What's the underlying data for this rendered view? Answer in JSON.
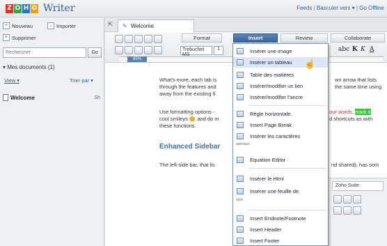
{
  "app": {
    "logo_letters": [
      "Z",
      "O",
      "H",
      "O"
    ],
    "logo_colors": [
      "#d9322b",
      "#3aa34a",
      "#2a73c7",
      "#e0a322"
    ],
    "name": "Writer"
  },
  "top_links": {
    "feeds": "Feeds",
    "sep1": "|",
    "switch": "Basculer vers",
    "switch_caret": "▾",
    "sep2": "|",
    "offline": "Go Offline"
  },
  "sidebar": {
    "new": "Nouveau",
    "import": "Importer",
    "delete": "Supprimer",
    "search_placeholder": "Rechercher",
    "search_go": "Go",
    "my_docs": "▾ Mes documents (1)",
    "view": "View ▾",
    "sort": "Trier par ▾",
    "documents": [
      {
        "name": "Welcome",
        "share": "Sh"
      }
    ]
  },
  "tabs": [
    {
      "label": "Welcome"
    }
  ],
  "ribbon": {
    "tabs": [
      "Format",
      "Insert",
      "Review",
      "Collaborate"
    ],
    "active": "Insert",
    "font": "Trebuchet MS",
    "size": "1",
    "zoom": "85%"
  },
  "content": {
    "p1": "What's more, each tab is",
    "p1b": "through the features and",
    "p1c": "away from the existing fi",
    "p1r": "wn arrow that lists",
    "p1r2": "the same time using",
    "p2": "Use formatting options -",
    "p2b": "cool smileys 😊 and do m",
    "p2c": "these functions.",
    "p2r": "our words,",
    "p2r_mark": "mark it",
    "p2r2": "d shortcuts as with",
    "heading": "Enhanced Sidebar",
    "p3": "The left-side bar, that lis",
    "p3r": "nd shared), has som"
  },
  "menu": {
    "items": [
      "Insérer une image",
      "Insérer un tableau",
      "Table des matières",
      "Insérer/modifier un lien",
      "Insérer/modifier l'ancre",
      "Règle horizontale",
      "Insert Page Break",
      "Insérer les caractères",
      "Equation Editor",
      "Insérer le Html",
      "Insérer une feuille de",
      "Insert Endnote/Footnote",
      "Insert Header",
      "Insert Footer"
    ],
    "caption_special": "spéciaux",
    "caption_style": "style",
    "hovered_index": 1
  },
  "mini_panel": {
    "tab": "Zoho Suite"
  }
}
